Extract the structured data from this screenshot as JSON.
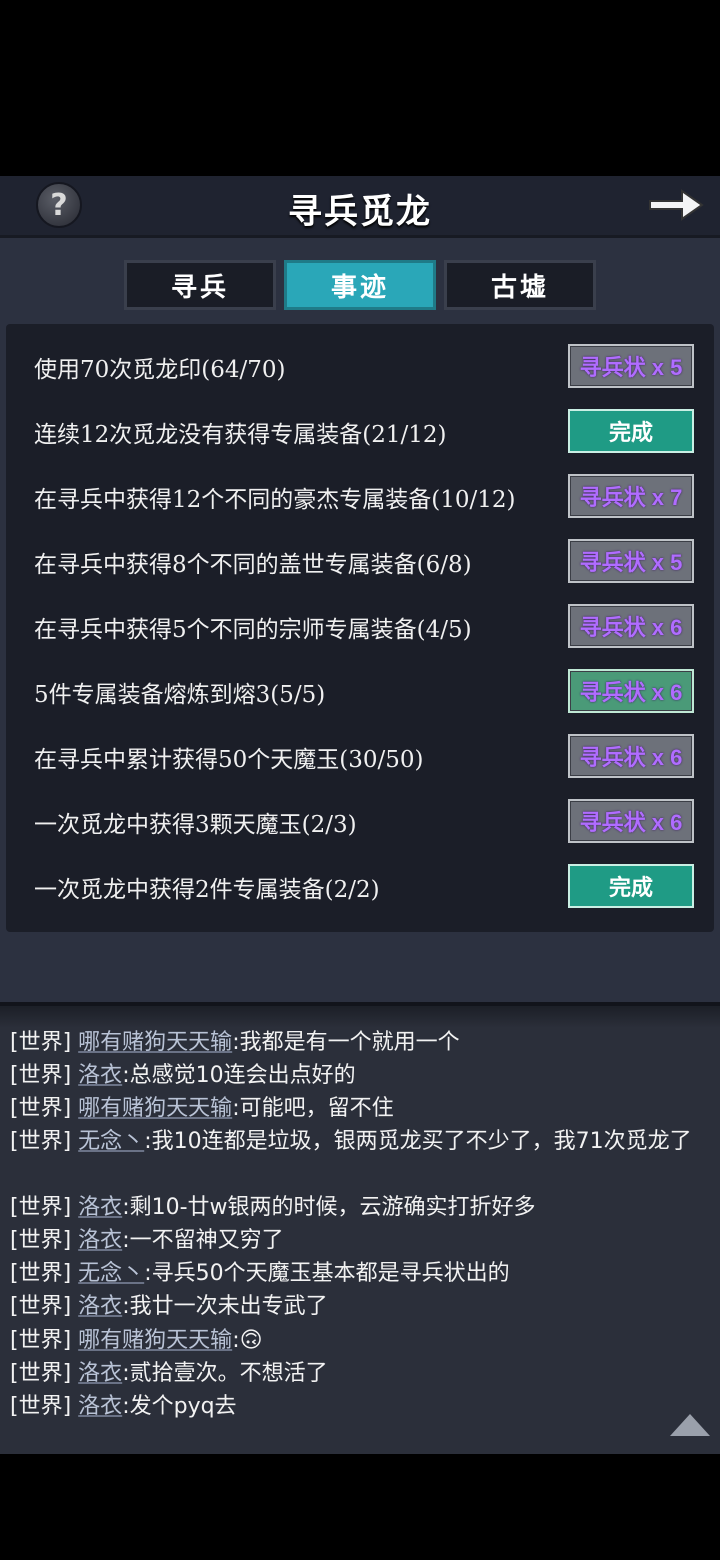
{
  "header": {
    "title": "寻兵觅龙",
    "help_icon": "question-mark-icon",
    "back_icon": "arrow-right-icon"
  },
  "tabs": [
    {
      "label": "寻兵",
      "active": false
    },
    {
      "label": "事迹",
      "active": true
    },
    {
      "label": "古墟",
      "active": false
    }
  ],
  "tasks": [
    {
      "text": "使用70次觅龙印(64/70)",
      "reward": "寻兵状 x 5",
      "status": "reward"
    },
    {
      "text": "连续12次觅龙没有获得专属装备(21/12)",
      "reward": "完成",
      "status": "done"
    },
    {
      "text": "在寻兵中获得12个不同的豪杰专属装备(10/12)",
      "reward": "寻兵状 x 7",
      "status": "reward"
    },
    {
      "text": "在寻兵中获得8个不同的盖世专属装备(6/8)",
      "reward": "寻兵状 x 5",
      "status": "reward"
    },
    {
      "text": "在寻兵中获得5个不同的宗师专属装备(4/5)",
      "reward": "寻兵状 x 6",
      "status": "reward"
    },
    {
      "text": "5件专属装备熔炼到熔3(5/5)",
      "reward": "寻兵状 x 6",
      "status": "claimable"
    },
    {
      "text": "在寻兵中累计获得50个天魔玉(30/50)",
      "reward": "寻兵状 x 6",
      "status": "reward"
    },
    {
      "text": "一次觅龙中获得3颗天魔玉(2/3)",
      "reward": "寻兵状 x 6",
      "status": "reward"
    },
    {
      "text": "一次觅龙中获得2件专属装备(2/2)",
      "reward": "完成",
      "status": "done"
    }
  ],
  "chat": {
    "channel_tag": "[世界]",
    "messages": [
      {
        "name": "哪有赌狗天天输",
        "text": ":我都是有一个就用一个"
      },
      {
        "name": "洛衣",
        "text": ":总感觉10连会出点好的"
      },
      {
        "name": "哪有赌狗天天输",
        "text": ":可能吧，留不住"
      },
      {
        "name": "无念丶",
        "text": ":我10连都是垃圾，银两觅龙买了不少了，我71次觅龙了"
      },
      {
        "name": "洛衣",
        "text": ":剩10-廿w银两的时候，云游确实打折好多"
      },
      {
        "name": "洛衣",
        "text": ":一不留神又穷了"
      },
      {
        "name": "无念丶",
        "text": ":寻兵50个天魔玉基本都是寻兵状出的"
      },
      {
        "name": "洛衣",
        "text": ":我廿一次未出专武了"
      },
      {
        "name": "哪有赌狗天天输",
        "text": ":🙃"
      },
      {
        "name": "洛衣",
        "text": ":贰拾壹次。不想活了"
      },
      {
        "name": "洛衣",
        "text": ":发个pyq去"
      }
    ],
    "scroll_icon": "up-arrow-icon"
  },
  "colors": {
    "accent_tab": "#2aa7b8",
    "done_button": "#1f9b85",
    "reward_text": "#b06cff"
  }
}
